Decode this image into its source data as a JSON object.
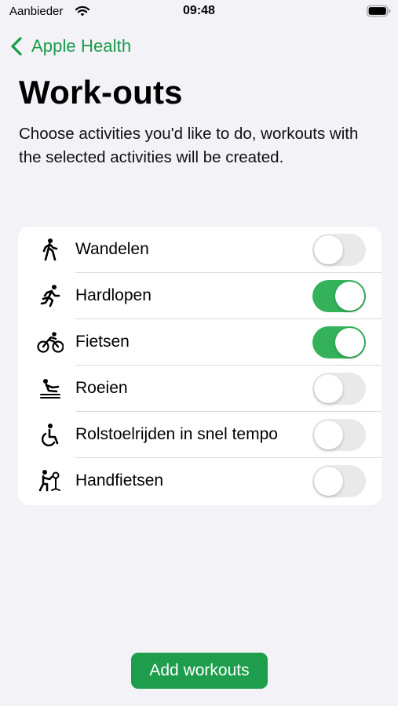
{
  "status_bar": {
    "carrier": "Aanbieder",
    "time": "09:48",
    "wifi_icon": "wifi-icon",
    "battery_icon": "battery-full-icon"
  },
  "nav": {
    "back_label": "Apple Health",
    "back_icon": "chevron-left-icon"
  },
  "page": {
    "title": "Work-outs",
    "subtitle": "Choose activities you'd like to do, workouts with the selected activities will be created."
  },
  "activities": [
    {
      "label": "Wandelen",
      "icon": "walking-icon",
      "enabled": false
    },
    {
      "label": "Hardlopen",
      "icon": "running-icon",
      "enabled": true
    },
    {
      "label": "Fietsen",
      "icon": "cycling-icon",
      "enabled": true
    },
    {
      "label": "Roeien",
      "icon": "rowing-icon",
      "enabled": false
    },
    {
      "label": "Rolstoelrijden in snel tempo",
      "icon": "wheelchair-icon",
      "enabled": false
    },
    {
      "label": "Handfietsen",
      "icon": "handcycling-icon",
      "enabled": false
    }
  ],
  "footer": {
    "add_button_label": "Add workouts"
  },
  "colors": {
    "accent": "#1e9e4c",
    "toggle_on": "#34b25a",
    "toggle_off": "#e9e9eb",
    "background": "#f2f2f7"
  }
}
